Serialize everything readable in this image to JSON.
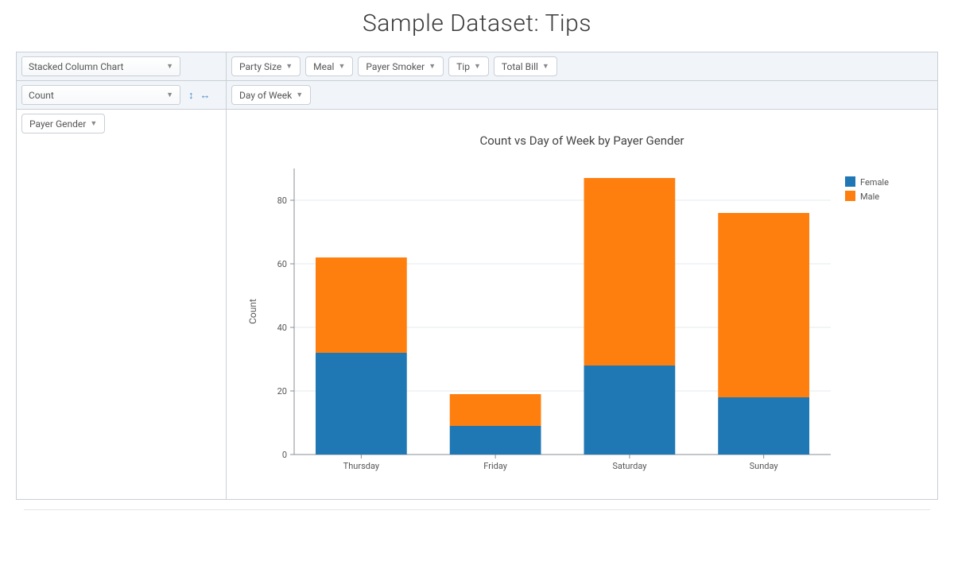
{
  "title": "Sample Dataset: Tips",
  "controls": {
    "chart_type": "Stacked Column Chart",
    "aggregator": "Count",
    "column_fields": [
      "Party Size",
      "Meal",
      "Payer Smoker",
      "Tip",
      "Total Bill"
    ],
    "row_field": "Day of Week",
    "series_field": "Payer Gender"
  },
  "chart_data": {
    "type": "bar",
    "stacked": true,
    "title": "Count vs Day of Week by Payer Gender",
    "xlabel": "",
    "ylabel": "Count",
    "ylim": [
      0,
      90
    ],
    "yticks": [
      0,
      20,
      40,
      60,
      80
    ],
    "categories": [
      "Thursday",
      "Friday",
      "Saturday",
      "Sunday"
    ],
    "series": [
      {
        "name": "Female",
        "color": "#1f77b4",
        "values": [
          32,
          9,
          28,
          18
        ]
      },
      {
        "name": "Male",
        "color": "#ff7f0e",
        "values": [
          30,
          10,
          59,
          58
        ]
      }
    ],
    "legend_position": "right"
  }
}
